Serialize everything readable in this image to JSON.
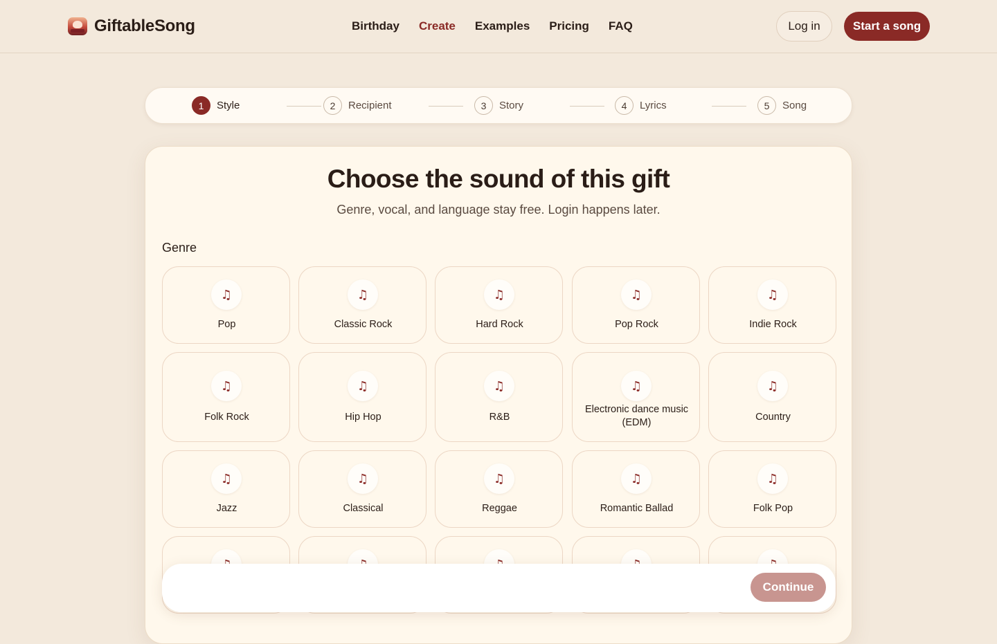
{
  "brand": {
    "name": "GiftableSong"
  },
  "nav": {
    "items": [
      {
        "label": "Birthday",
        "active": false
      },
      {
        "label": "Create",
        "active": true
      },
      {
        "label": "Examples",
        "active": false
      },
      {
        "label": "Pricing",
        "active": false
      },
      {
        "label": "FAQ",
        "active": false
      }
    ],
    "login_label": "Log in",
    "start_label": "Start a song"
  },
  "stepper": {
    "steps": [
      {
        "num": "1",
        "label": "Style",
        "active": true
      },
      {
        "num": "2",
        "label": "Recipient",
        "active": false
      },
      {
        "num": "3",
        "label": "Story",
        "active": false
      },
      {
        "num": "4",
        "label": "Lyrics",
        "active": false
      },
      {
        "num": "5",
        "label": "Song",
        "active": false
      }
    ]
  },
  "main": {
    "title": "Choose the sound of this gift",
    "subtitle": "Genre, vocal, and language stay free. Login happens later.",
    "genre_label": "Genre",
    "genre_icon": "music-note-icon",
    "genres": [
      "Pop",
      "Classic Rock",
      "Hard Rock",
      "Pop Rock",
      "Indie Rock",
      "Folk Rock",
      "Hip Hop",
      "R&B",
      "Electronic dance music (EDM)",
      "Country",
      "Jazz",
      "Classical",
      "Reggae",
      "Romantic Ballad",
      "Folk Pop"
    ]
  },
  "footer_bar": {
    "continue_label": "Continue"
  },
  "colors": {
    "accent": "#8a2a26",
    "background": "#f3e9dc",
    "card": "#fff8ec",
    "continue_disabled": "#c89590"
  }
}
